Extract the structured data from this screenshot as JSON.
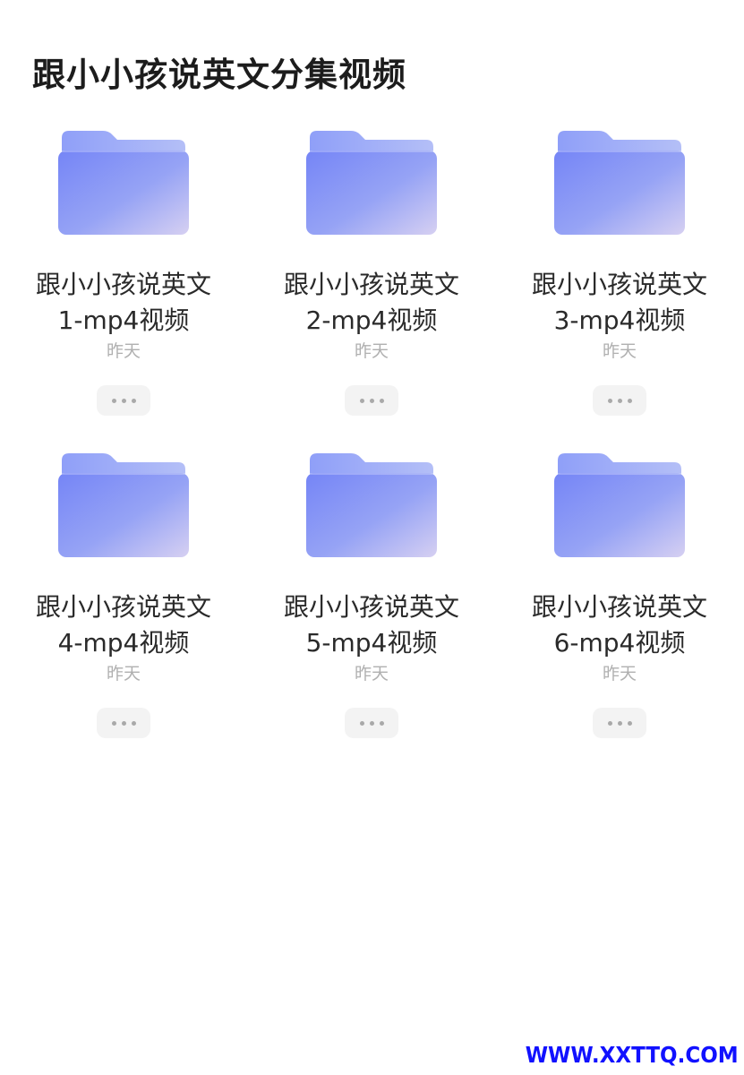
{
  "page": {
    "title": "跟小小孩说英文分集视频"
  },
  "folders": [
    {
      "name_line1": "跟小小孩说英文",
      "name_line2": "1-mp4视频",
      "date": "昨天",
      "icon": "folder-icon",
      "more_icon": "more-dots-icon"
    },
    {
      "name_line1": "跟小小孩说英文",
      "name_line2": "2-mp4视频",
      "date": "昨天",
      "icon": "folder-icon",
      "more_icon": "more-dots-icon"
    },
    {
      "name_line1": "跟小小孩说英文",
      "name_line2": "3-mp4视频",
      "date": "昨天",
      "icon": "folder-icon",
      "more_icon": "more-dots-icon"
    },
    {
      "name_line1": "跟小小孩说英文",
      "name_line2": "4-mp4视频",
      "date": "昨天",
      "icon": "folder-icon",
      "more_icon": "more-dots-icon"
    },
    {
      "name_line1": "跟小小孩说英文",
      "name_line2": "5-mp4视频",
      "date": "昨天",
      "icon": "folder-icon",
      "more_icon": "more-dots-icon"
    },
    {
      "name_line1": "跟小小孩说英文",
      "name_line2": "6-mp4视频",
      "date": "昨天",
      "icon": "folder-icon",
      "more_icon": "more-dots-icon"
    }
  ],
  "watermark": {
    "text": "WWW.XXTTQ.COM"
  },
  "colors": {
    "folder_front_start": "#7f8ff7",
    "folder_front_end": "#d4cdf2",
    "folder_back": "#9aaaf8",
    "watermark": "#1111ff",
    "date_text": "#b0b0b0"
  }
}
